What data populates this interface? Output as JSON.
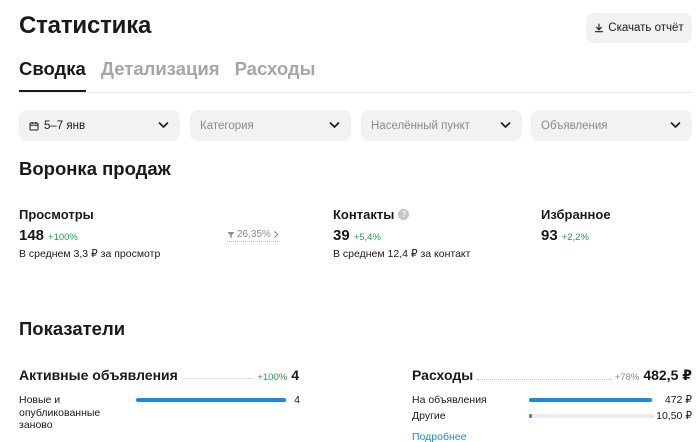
{
  "header": {
    "title": "Статистика",
    "download_label": "Скачать отчёт"
  },
  "tabs": [
    {
      "label": "Сводка",
      "active": true
    },
    {
      "label": "Детализация",
      "active": false
    },
    {
      "label": "Расходы",
      "active": false
    }
  ],
  "filters": {
    "date": "5–7 янв",
    "category": "Категория",
    "location": "Населённый пункт",
    "listings": "Объявления"
  },
  "funnel": {
    "title": "Воронка продаж",
    "views": {
      "name": "Просмотры",
      "value": "148",
      "delta": "+100%",
      "sub": "В среднем 3,3 ₽ за просмотр"
    },
    "conversion": "26,35%",
    "contacts": {
      "name": "Контакты",
      "value": "39",
      "delta": "+5,4%",
      "sub": "В среднем 12,4 ₽ за контакт"
    },
    "favorites": {
      "name": "Избранное",
      "value": "93",
      "delta": "+2,2%"
    }
  },
  "indicators": {
    "title": "Показатели",
    "active_listings": {
      "title": "Активные объявления",
      "delta": "+100%",
      "value": "4",
      "rows": [
        {
          "label": "Новые и опубликованные заново",
          "value": "4",
          "fraction": 1.0
        }
      ]
    },
    "expenses": {
      "title": "Расходы",
      "delta": "+78%",
      "value": "482,5 ₽",
      "rows": [
        {
          "label": "На объявления",
          "value": "472 ₽",
          "fraction": 0.978
        },
        {
          "label": "Другие",
          "value": "10,50 ₽",
          "fraction": 0.022
        }
      ],
      "more_label": "Подробнее"
    }
  },
  "colors": {
    "accent_blue": "#1e88e5",
    "positive_green": "#1fa34a",
    "muted_grey": "#8a8a8a",
    "pill_bg": "#f2f2f2"
  }
}
